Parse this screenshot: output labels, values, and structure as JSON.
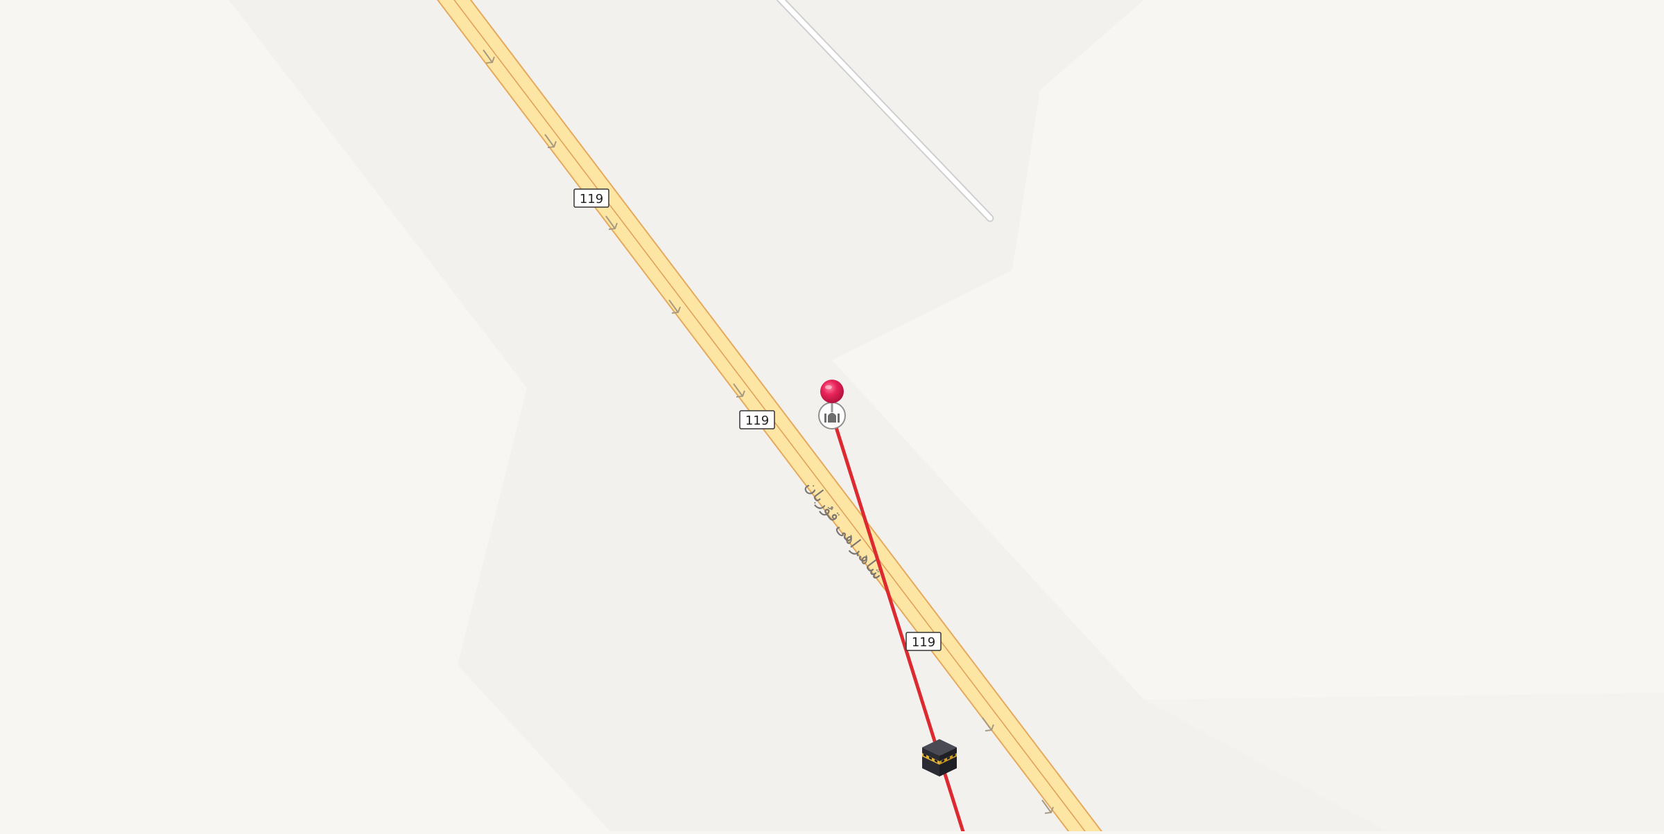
{
  "map": {
    "colors": {
      "background": "#f8f6f3",
      "landuse_patch": "#f3f1ee",
      "highway_fill": "#fde6a3",
      "highway_casing": "#e6a85a",
      "highway_center": "#e0a25a",
      "minor_road": "#ffffff",
      "minor_road_casing": "#cfcfcf",
      "direction_arrow": "#a89a80",
      "road_label": "#7a7570",
      "shield_border": "#333333",
      "qibla_line": "#dd2a30",
      "pin": "#e8245a"
    },
    "roads": [
      {
        "class": "highway",
        "ref": "119",
        "name": "ﺷﺎھﺮﺍﮬﻰ ﻗﯘﺭﺑﺎﻥ",
        "shields": [
          "119",
          "119",
          "119"
        ]
      },
      {
        "class": "minor"
      }
    ],
    "markers": [
      {
        "name": "location-pin",
        "icon": "red-pin-icon"
      },
      {
        "name": "mosque",
        "icon": "mosque-icon"
      },
      {
        "name": "kaaba",
        "icon": "kaaba-icon"
      }
    ],
    "qibla_line": {
      "from": "mosque",
      "toward": "kaaba"
    }
  }
}
